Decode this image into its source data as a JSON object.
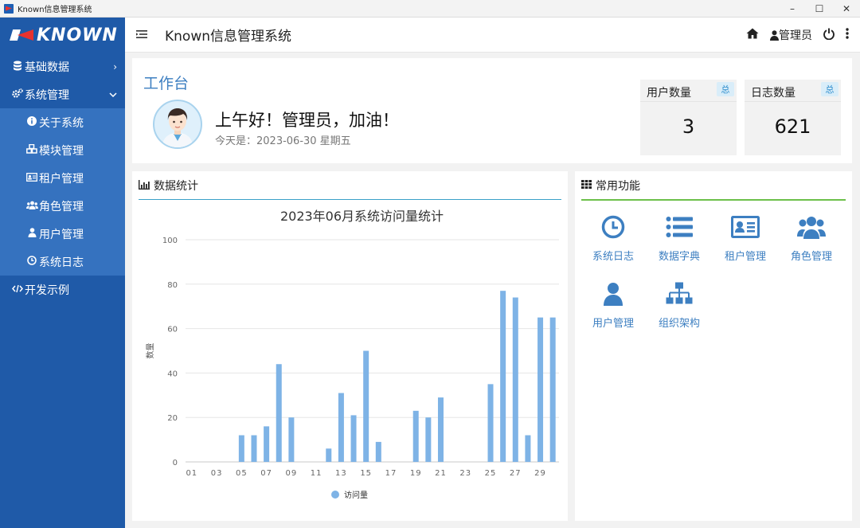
{
  "window": {
    "title": "Known信息管理系统",
    "minimize": "–",
    "maximize": "☐",
    "close": "✕"
  },
  "sidebar": {
    "logo_text": "KNOWN",
    "items": [
      {
        "label": "基础数据",
        "icon": "database-icon",
        "arrow": "›"
      },
      {
        "label": "系统管理",
        "icon": "gears-icon",
        "arrow": "⌄"
      }
    ],
    "submenu": [
      {
        "label": "关于系统",
        "icon": "info-icon"
      },
      {
        "label": "模块管理",
        "icon": "cubes-icon"
      },
      {
        "label": "租户管理",
        "icon": "id-card-icon"
      },
      {
        "label": "角色管理",
        "icon": "users-icon"
      },
      {
        "label": "用户管理",
        "icon": "user-icon"
      },
      {
        "label": "系统日志",
        "icon": "clock-icon"
      }
    ],
    "bottom_item": {
      "label": "开发示例",
      "icon": "code-icon"
    }
  },
  "header": {
    "title": "Known信息管理系统",
    "user": "管理员"
  },
  "workbench": {
    "title": "工作台",
    "greeting": "上午好！管理员，加油！",
    "today": "今天是：2023-06-30 星期五",
    "stats": [
      {
        "label": "用户数量",
        "badge": "总",
        "value": "3"
      },
      {
        "label": "日志数量",
        "badge": "总",
        "value": "621"
      }
    ]
  },
  "stats_panel": {
    "title": "数据统计"
  },
  "func_panel": {
    "title": "常用功能",
    "items": [
      {
        "label": "系统日志",
        "icon": "clock-icon"
      },
      {
        "label": "数据字典",
        "icon": "list-icon"
      },
      {
        "label": "租户管理",
        "icon": "id-card-icon"
      },
      {
        "label": "角色管理",
        "icon": "users-icon"
      },
      {
        "label": "用户管理",
        "icon": "user-icon"
      },
      {
        "label": "组织架构",
        "icon": "sitemap-icon"
      }
    ]
  },
  "colors": {
    "sidebar": "#1f5aa8",
    "submenu": "#3572bf",
    "accent": "#3d7fc1",
    "bar": "#7eb3e6"
  },
  "chart_data": {
    "type": "bar",
    "title": "2023年06月系统访问量统计",
    "ylabel": "数量",
    "ylim": [
      0,
      100
    ],
    "yticks": [
      0,
      20,
      40,
      60,
      80,
      100
    ],
    "x_tick_labels": [
      "01",
      "03",
      "05",
      "07",
      "09",
      "11",
      "13",
      "15",
      "17",
      "19",
      "21",
      "23",
      "25",
      "27",
      "29"
    ],
    "categories": [
      "01",
      "02",
      "03",
      "04",
      "05",
      "06",
      "07",
      "08",
      "09",
      "10",
      "11",
      "12",
      "13",
      "14",
      "15",
      "16",
      "17",
      "18",
      "19",
      "20",
      "21",
      "22",
      "23",
      "24",
      "25",
      "26",
      "27",
      "28",
      "29",
      "30"
    ],
    "series": [
      {
        "name": "访问量",
        "values": [
          0,
          0,
          0,
          0,
          12,
          12,
          16,
          44,
          20,
          0,
          0,
          6,
          31,
          21,
          50,
          9,
          0,
          0,
          23,
          20,
          29,
          0,
          0,
          0,
          35,
          77,
          74,
          12,
          65,
          65
        ]
      }
    ],
    "grid": true,
    "legend": "bottom"
  }
}
